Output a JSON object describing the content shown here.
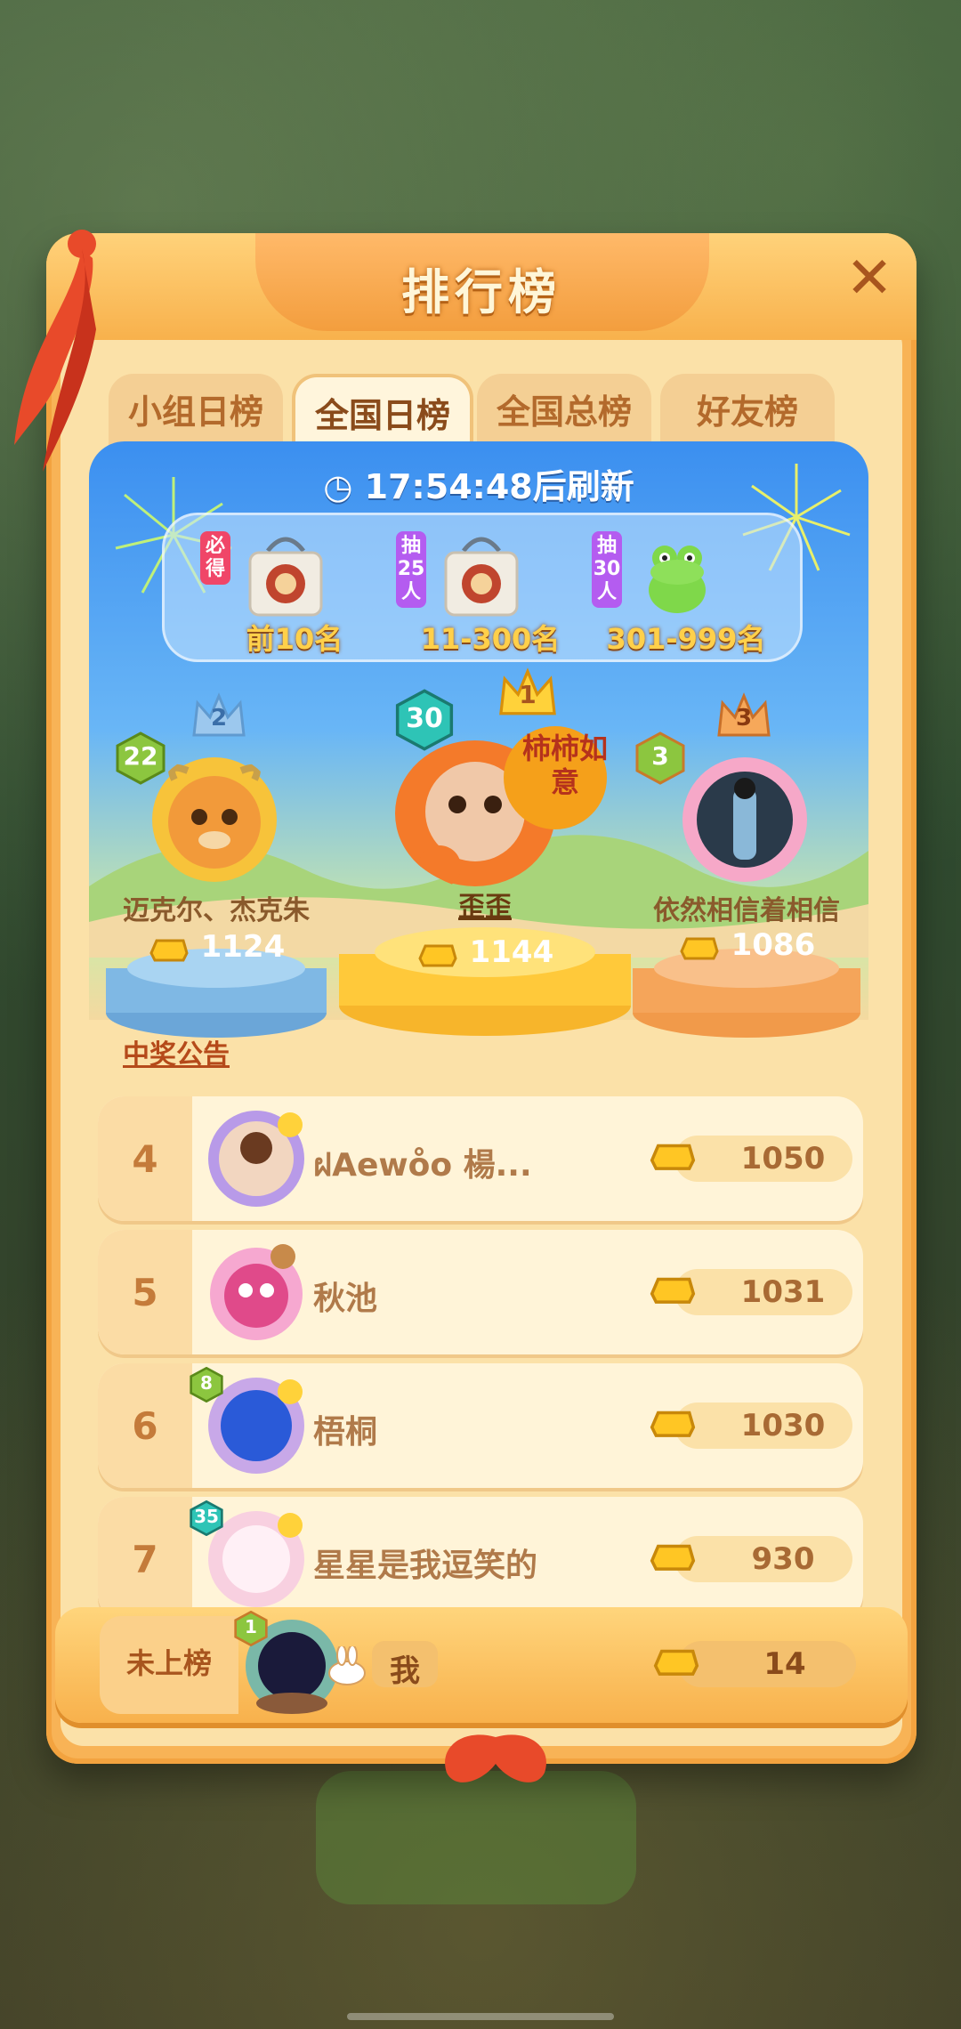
{
  "modal": {
    "title": "排行榜",
    "close_label": "✕"
  },
  "tabs": [
    {
      "label": "小组日榜",
      "active": false
    },
    {
      "label": "全国日榜",
      "active": true
    },
    {
      "label": "全国总榜",
      "active": false
    },
    {
      "label": "好友榜",
      "active": false
    }
  ],
  "refresh": {
    "icon": "clock-icon",
    "text": "17:54:48后刷新"
  },
  "rewards": [
    {
      "tag": "必得",
      "label": "前10名"
    },
    {
      "tag": "抽25人",
      "label": "11-300名"
    },
    {
      "tag": "抽30人",
      "label": "301-999名"
    }
  ],
  "podium": {
    "first": {
      "rank": "1",
      "level": "30",
      "name": "歪歪",
      "score": "1144",
      "badge": "柿柿如意"
    },
    "second": {
      "rank": "2",
      "level": "22",
      "name": "迈克尔、杰克朱",
      "score": "1124"
    },
    "third": {
      "rank": "3",
      "level": "3",
      "name": "依然相信着相信",
      "score": "1086"
    }
  },
  "announcement": "中奖公告",
  "rows": [
    {
      "rank": "4",
      "name": "ฝAewo̊o 楊...",
      "score": "1050",
      "level": ""
    },
    {
      "rank": "5",
      "name": "秋池",
      "score": "1031",
      "level": ""
    },
    {
      "rank": "6",
      "name": "梧桐",
      "score": "1030",
      "level": "8"
    },
    {
      "rank": "7",
      "name": "星星是我逗笑的",
      "score": "930",
      "level": "35"
    }
  ],
  "me": {
    "rank": "未上榜",
    "name": "我",
    "score": "14",
    "level": "1"
  },
  "colors": {
    "accent": "#f8b356",
    "panel_top": "#3b8ff0",
    "gold_text": "#ffd04a"
  }
}
